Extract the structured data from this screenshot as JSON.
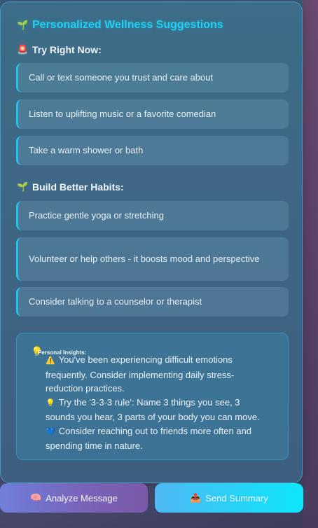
{
  "panel": {
    "title_icon": "🌱",
    "title": "Personalized Wellness Suggestions"
  },
  "try_now": {
    "icon": "🚨",
    "title": "Try Right Now:",
    "items": [
      "Call or text someone you trust and care about",
      "Listen to uplifting music or a favorite comedian",
      "Take a warm shower or bath"
    ]
  },
  "habits": {
    "icon": "🌱",
    "title": "Build Better Habits:",
    "items": [
      "Practice gentle yoga or stretching",
      "Volunteer or help others - it boosts mood and perspective",
      "Consider talking to a counselor or therapist"
    ]
  },
  "insights": {
    "icon": "💡",
    "label": "Personal Insights:",
    "lines": [
      {
        "icon": "⚠️",
        "text": "You've been experiencing difficult emotions frequently. Consider implementing daily stress-reduction practices."
      },
      {
        "icon": "💡",
        "text": "Try the '3-3-3 rule': Name 3 things you see, 3 sounds you hear, 3 parts of your body you can move."
      },
      {
        "icon": "💙",
        "text": "Consider reaching out to friends more often and spending time in nature."
      }
    ]
  },
  "buttons": {
    "analyze_icon": "🧠",
    "analyze_label": "Analyze Message",
    "send_icon": "📤",
    "send_label": "Send Summary"
  }
}
